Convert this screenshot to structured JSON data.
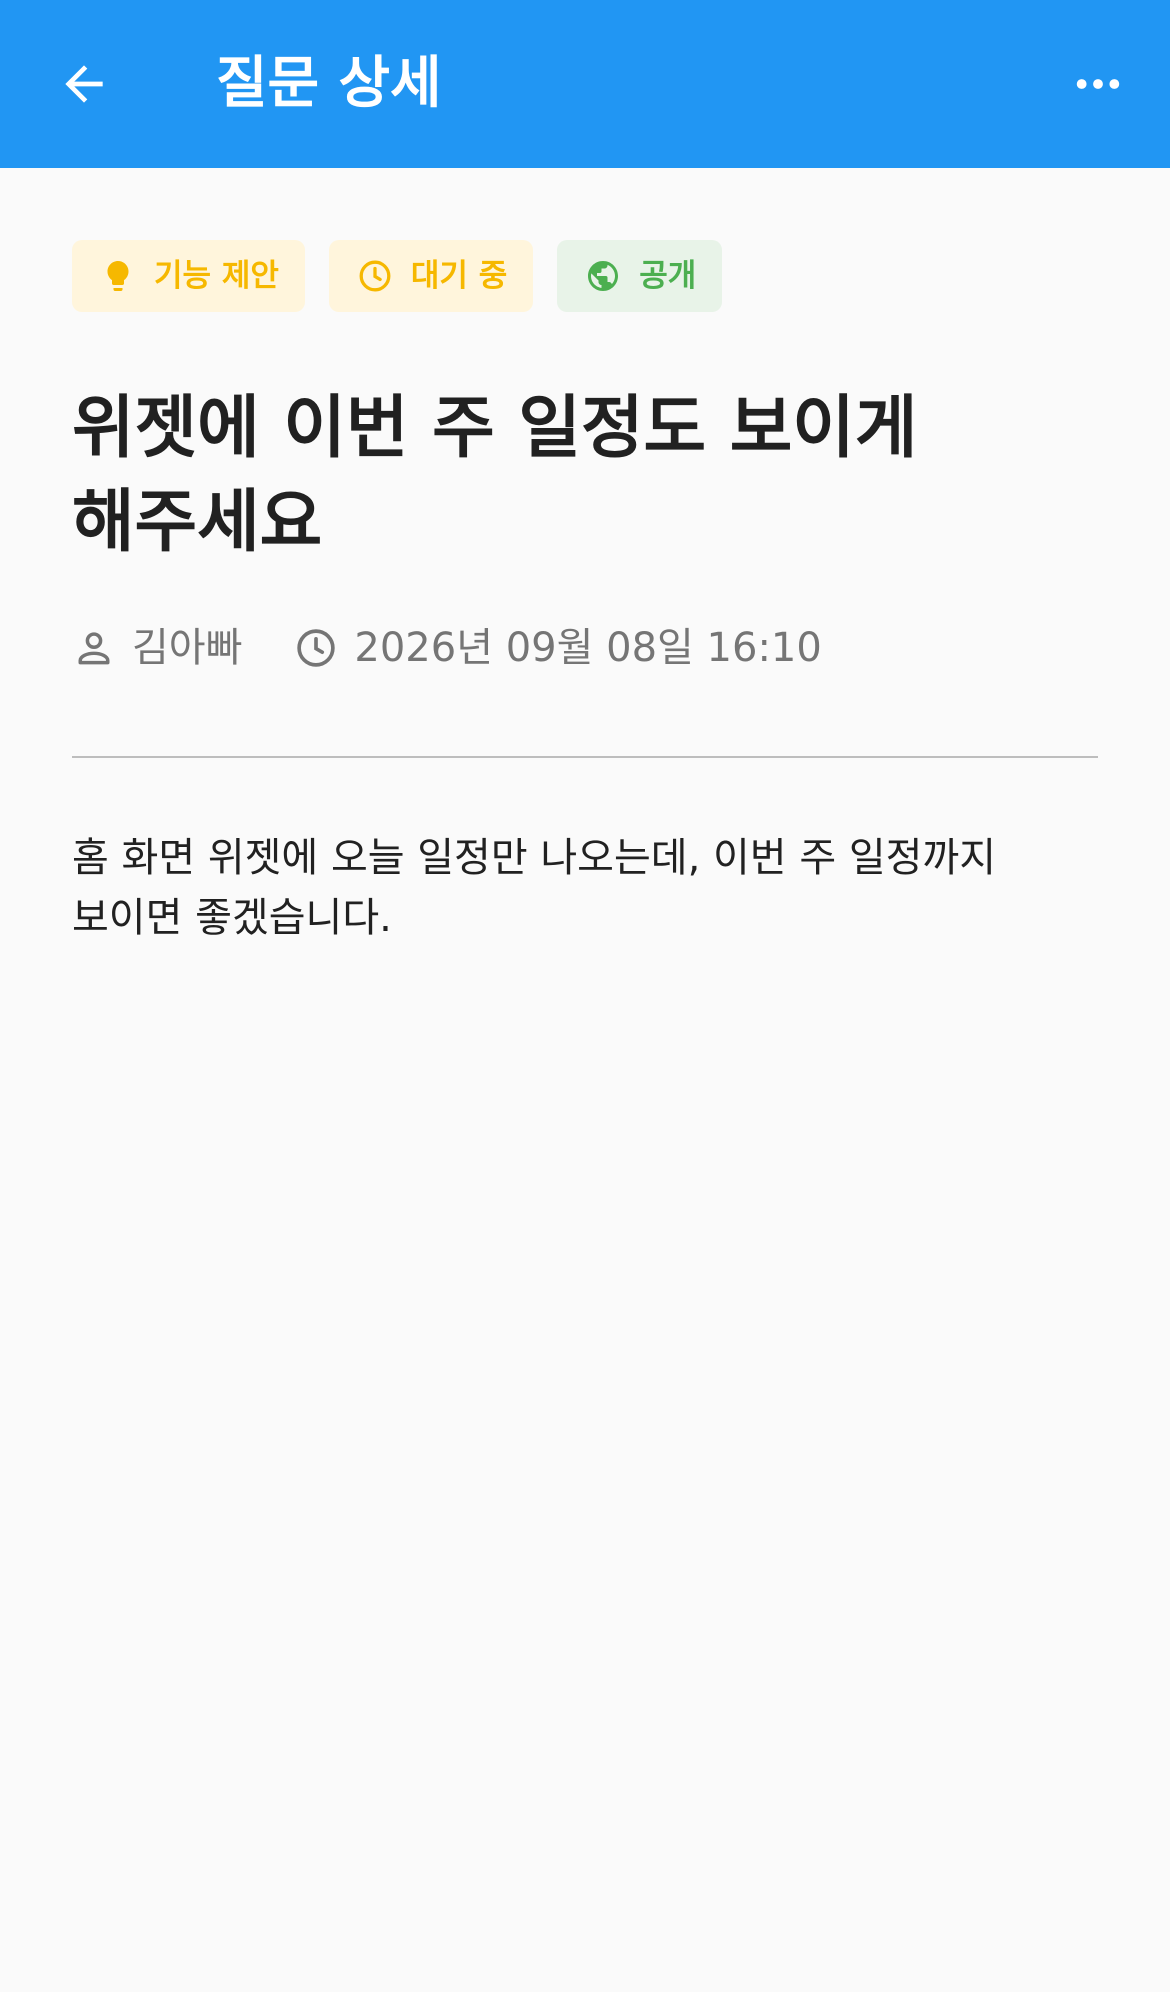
{
  "appbar": {
    "title": "질문 상세",
    "background": "#2196f3",
    "back_icon": "arrow-left-icon",
    "more_icon": "more-horizontal-icon"
  },
  "chips": [
    {
      "label": "기능 제안",
      "icon": "lightbulb-icon",
      "color": "#f6b800",
      "background": "#fff5dc"
    },
    {
      "label": "대기 중",
      "icon": "clock-icon",
      "color": "#f6b800",
      "background": "#fff5dc"
    },
    {
      "label": "공개",
      "icon": "globe-icon",
      "color": "#4caf50",
      "background": "#e8f3e8"
    }
  ],
  "question": {
    "title": "위젯에 이번 주 일정도 보이게 해주세요",
    "author": "김아빠",
    "datetime": "2026년 09월 08일 16:10",
    "body": "홈 화면 위젯에 오늘 일정만 나오는데, 이번 주 일정까지 보이면 좋겠습니다."
  }
}
